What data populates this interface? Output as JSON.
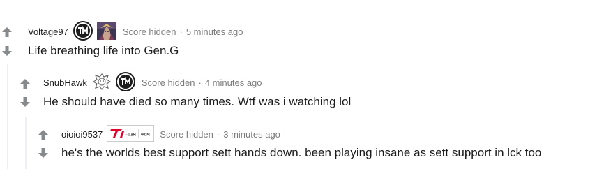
{
  "comments": [
    {
      "username": "Voltage97",
      "flairs": [
        "tsm-flair-icon",
        "champion-portrait-icon"
      ],
      "score": "Score hidden",
      "separator": "·",
      "time": "5 minutes ago",
      "body": "Life breathing life into Gen.G"
    },
    {
      "username": "SnubHawk",
      "flairs": [
        "g2-flair-icon",
        "tsm-flair-icon"
      ],
      "score": "Score hidden",
      "separator": "·",
      "time": "4 minutes ago",
      "body": "He should have died so many times. Wtf was i watching lol"
    },
    {
      "username": "oioioi9537",
      "flairs": [
        "t1-damwon-flair-icon"
      ],
      "score": "Score hidden",
      "separator": "·",
      "time": "3 minutes ago",
      "body": "he's the worlds best support sett hands down. been playing insane as sett support in lck too"
    }
  ],
  "colors": {
    "arrow": "#878a8c",
    "meta_text": "#7c7c7c",
    "body_text": "#1c1c1c",
    "thread_line": "#edeff1",
    "t1_red": "#e4002b"
  }
}
